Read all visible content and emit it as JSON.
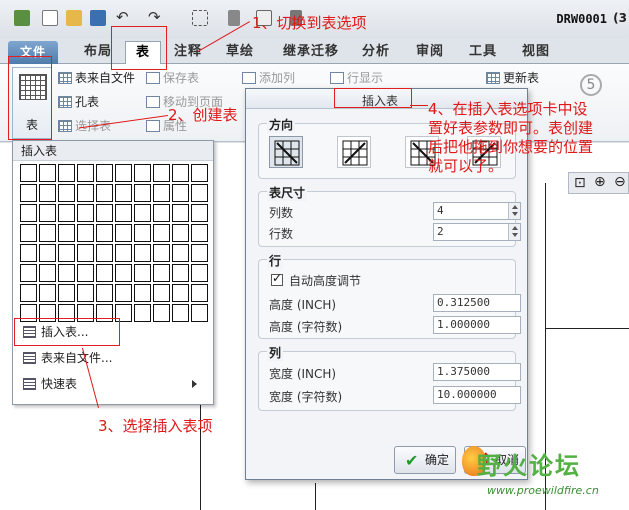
{
  "toolbar": {
    "file_name": "DRW0001",
    "title_tail": "(3"
  },
  "tabs": [
    {
      "label": "文件"
    },
    {
      "label": "布局"
    },
    {
      "label": "表"
    },
    {
      "label": "注释"
    },
    {
      "label": "草绘"
    },
    {
      "label": "继承迁移"
    },
    {
      "label": "分析"
    },
    {
      "label": "审阅"
    },
    {
      "label": "工具"
    },
    {
      "label": "视图"
    }
  ],
  "ribbon": {
    "big_table_label": "表",
    "table_from_file": "表来自文件",
    "hole_table": "孔表",
    "select_table": "选择表",
    "save_table": "保存表",
    "move_to_page": "移动到页面",
    "properties": "属性",
    "add_column": "添加列",
    "row_display": "行显示",
    "update_table": "更新表",
    "badge": "5"
  },
  "menu": {
    "header": "插入表",
    "insert_table": "插入表...",
    "table_from_file": "表来自文件...",
    "quick_table": "快速表"
  },
  "dialog": {
    "title": "插入表",
    "direction_label": "方向",
    "table_size_label": "表尺寸",
    "columns_label": "列数",
    "columns_value": "4",
    "rows_label": "行数",
    "rows_value": "2",
    "row_group_label": "行",
    "auto_height_label": "自动高度调节",
    "height_inch_label": "高度 (INCH)",
    "height_inch_value": "0.312500",
    "height_chars_label": "高度 (字符数)",
    "height_chars_value": "1.000000",
    "column_group_label": "列",
    "width_inch_label": "宽度 (INCH)",
    "width_inch_value": "1.375000",
    "width_chars_label": "宽度 (字符数)",
    "width_chars_value": "10.000000",
    "ok_label": "确定",
    "cancel_label": "取消"
  },
  "annotations": {
    "step1": "1、切换到表选项",
    "step2": "2、创建表",
    "step3": "3、选择插入表项",
    "step4_line1": "4、在插入表选项卡中设",
    "step4_line2": "置好表参数即可。表创建",
    "step4_line3": "后把他拖到你想要的位置",
    "step4_line4": "就可以了。"
  },
  "watermark": {
    "name": "野火论坛",
    "url": "www.proewildfire.cn"
  },
  "colors": {
    "annotation": "#e01818",
    "watermark": "#53b043",
    "file_tab": "#4f7bab"
  }
}
